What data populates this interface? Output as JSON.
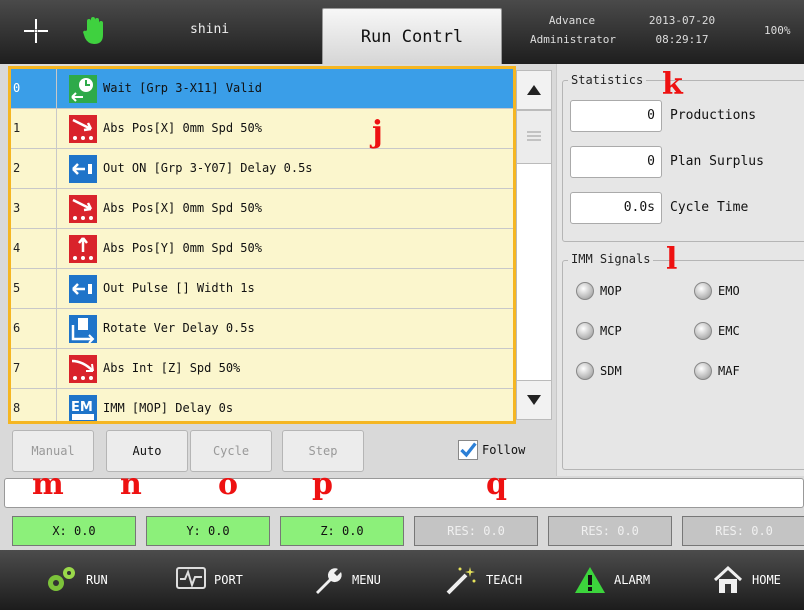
{
  "header": {
    "user": "shini",
    "active_tab": "Run Contrl",
    "level_type": "Advance",
    "level_name": "Administrator",
    "date": "2013-07-20",
    "time": "08:29:17",
    "battery": "100%"
  },
  "program": {
    "rows": [
      {
        "num": "0",
        "text": "Wait [Grp 3-X11] Valid",
        "icon": "wait-icon"
      },
      {
        "num": "1",
        "text": "Abs Pos[X] 0mm Spd 50%",
        "icon": "move-x-icon"
      },
      {
        "num": "2",
        "text": "Out ON [Grp 3-Y07] Delay 0.5s",
        "icon": "output-icon"
      },
      {
        "num": "3",
        "text": "Abs Pos[X] 0mm Spd 50%",
        "icon": "move-x-icon"
      },
      {
        "num": "4",
        "text": "Abs Pos[Y] 0mm Spd 50%",
        "icon": "move-y-icon"
      },
      {
        "num": "5",
        "text": "Out Pulse [] Width 1s",
        "icon": "output-icon"
      },
      {
        "num": "6",
        "text": "Rotate Ver Delay 0.5s",
        "icon": "rotate-icon"
      },
      {
        "num": "7",
        "text": "Abs Int [Z] Spd 50%",
        "icon": "interp-icon"
      },
      {
        "num": "8",
        "text": "IMM [MOP] Delay 0s",
        "icon": "imm-icon"
      }
    ],
    "selected_index": 0
  },
  "statistics": {
    "title": "Statistics",
    "productions_value": "0",
    "productions_label": "Productions",
    "plan_value": "0",
    "plan_label": "Plan Surplus",
    "cycle_value": "0.0s",
    "cycle_label": "Cycle Time"
  },
  "imm": {
    "title": "IMM Signals",
    "signals": [
      "MOP",
      "EMO",
      "MCP",
      "EMC",
      "SDM",
      "MAF"
    ]
  },
  "modes": {
    "manual": "Manual",
    "auto": "Auto",
    "cycle": "Cycle",
    "step": "Step",
    "follow": "Follow"
  },
  "annotations": {
    "j": "j",
    "k": "k",
    "l": "l",
    "m": "m",
    "n": "n",
    "o": "o",
    "p": "p",
    "q": "q"
  },
  "axes": [
    "X: 0.0",
    "Y: 0.0",
    "Z: 0.0",
    "RES: 0.0",
    "RES: 0.0",
    "RES: 0.0"
  ],
  "nav": {
    "run": "RUN",
    "port": "PORT",
    "menu": "MENU",
    "teach": "TEACH",
    "alarm": "ALARM",
    "home": "HOME"
  },
  "colors": {
    "selected_row": "#3a9ee8",
    "row_bg": "#fbf6cd",
    "panel_border": "#f5b622",
    "axis_on": "#8cf07a",
    "annotation": "#ee1111"
  }
}
